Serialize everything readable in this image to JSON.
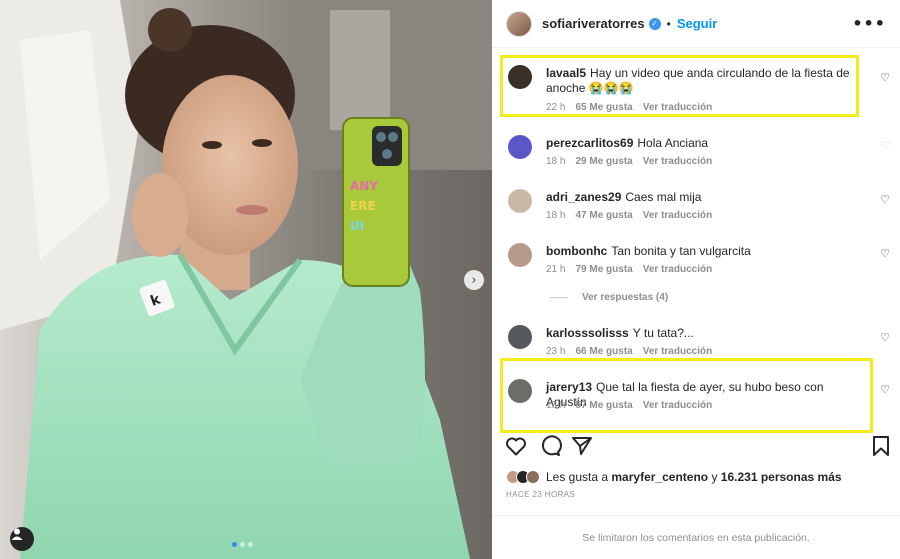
{
  "post": {
    "username": "sofiariveratorres",
    "follow_label": "Seguir",
    "dot": "•",
    "more_label": "•••",
    "next_arrow": "›",
    "carousel_count": 3,
    "carousel_active": 0
  },
  "comments": [
    {
      "user": "lavaal5",
      "text": "Hay un video que anda circulando de la fiesta de anoche 😭😭😭",
      "time": "22 h",
      "likes": "65 Me gusta",
      "translate": "Ver traducción",
      "highlighted": true,
      "avatar_color": "#3a3028"
    },
    {
      "user": "perezcarlitos69",
      "text": "Hola Anciana",
      "time": "18 h",
      "likes": "29 Me gusta",
      "translate": "Ver traducción",
      "highlighted": false,
      "avatar_color": "#5b57c9"
    },
    {
      "user": "adri_zanes29",
      "text": "Caes mal mija",
      "time": "18 h",
      "likes": "47 Me gusta",
      "translate": "Ver traducción",
      "highlighted": false,
      "avatar_color": "#c9b9a7"
    },
    {
      "user": "bombonhc",
      "text": "Tan bonita y tan vulgarcita",
      "time": "21 h",
      "likes": "79 Me gusta",
      "translate": "Ver traducción",
      "highlighted": false,
      "avatar_color": "#b89a8a"
    },
    {
      "user": "karlosssolisss",
      "text": "Y tu tata?...",
      "time": "23 h",
      "likes": "66 Me gusta",
      "translate": "Ver traducción",
      "highlighted": false,
      "avatar_color": "#55585c"
    },
    {
      "user": "jarery13",
      "text": "Que tal la fiesta de ayer, su hubo beso con Agustín",
      "time": "18 h",
      "likes": "57 Me gusta",
      "translate": "Ver traducción",
      "highlighted": true,
      "avatar_color": "#6b6e66"
    }
  ],
  "view_replies": "Ver respuestas (4)",
  "heart_icon": "♡",
  "likes_line": {
    "prefix": "Les gusta a",
    "user": "maryfer_centeno",
    "middle": "y",
    "count": "16.231 personas más"
  },
  "time_ago": "HACE 23 HORAS",
  "footer_text": "Se limitaron los comentarios en esta publicación.",
  "colors": {
    "accent": "#0095f6",
    "highlight": "#f4ec1c",
    "sweatshirt": "#a9e3c3"
  }
}
